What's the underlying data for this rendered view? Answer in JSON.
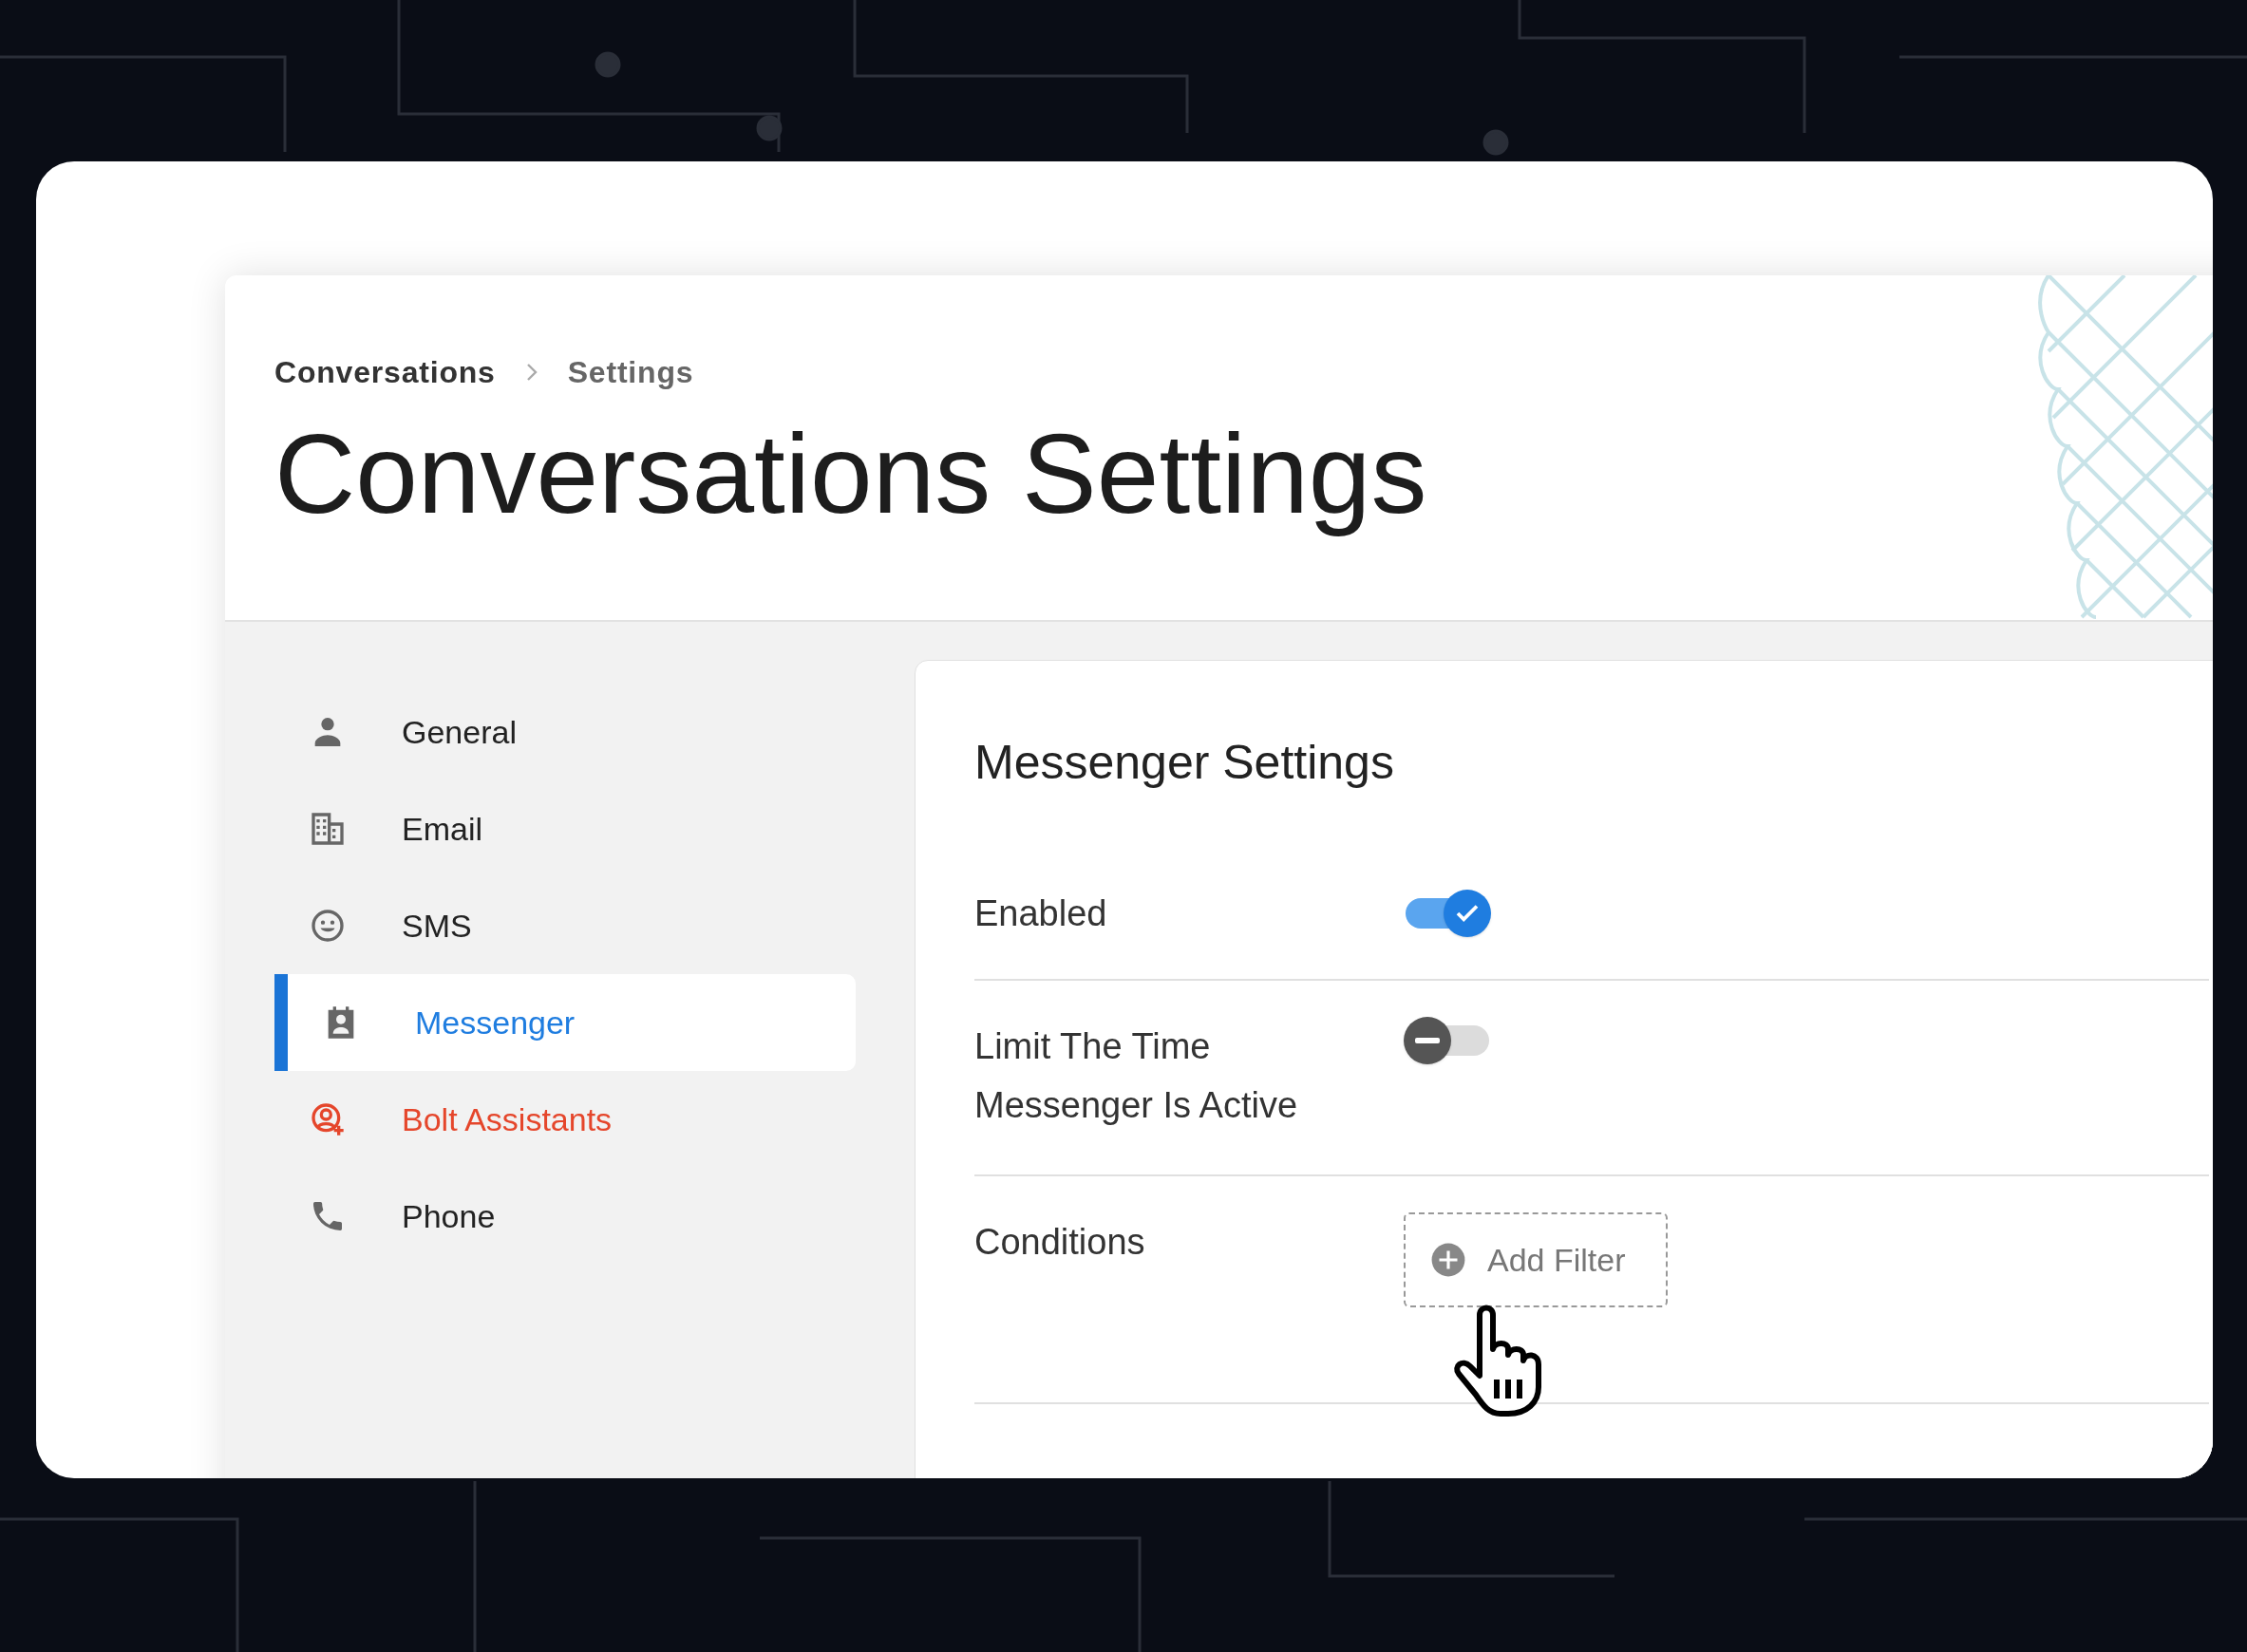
{
  "breadcrumb": [
    {
      "label": "Conversations"
    },
    {
      "label": "Settings"
    }
  ],
  "title": "Conversations Settings",
  "sidebar": {
    "items": [
      {
        "label": "General",
        "kind": "person",
        "selected": false,
        "promo": false
      },
      {
        "label": "Email",
        "kind": "building",
        "selected": false,
        "promo": false
      },
      {
        "label": "SMS",
        "kind": "smiley",
        "selected": false,
        "promo": false
      },
      {
        "label": "Messenger",
        "kind": "contact",
        "selected": true,
        "promo": false
      },
      {
        "label": "Bolt Assistants",
        "kind": "assistant",
        "selected": false,
        "promo": true
      },
      {
        "label": "Phone",
        "kind": "phone",
        "selected": false,
        "promo": false
      }
    ]
  },
  "panel": {
    "title": "Messenger Settings",
    "rows": [
      {
        "label": "Enabled",
        "kind": "toggle",
        "on": true
      },
      {
        "label": "Limit The Time Messenger Is Active",
        "kind": "toggle",
        "on": false
      },
      {
        "label": "Conditions",
        "kind": "filter",
        "button": "Add Filter"
      }
    ]
  }
}
